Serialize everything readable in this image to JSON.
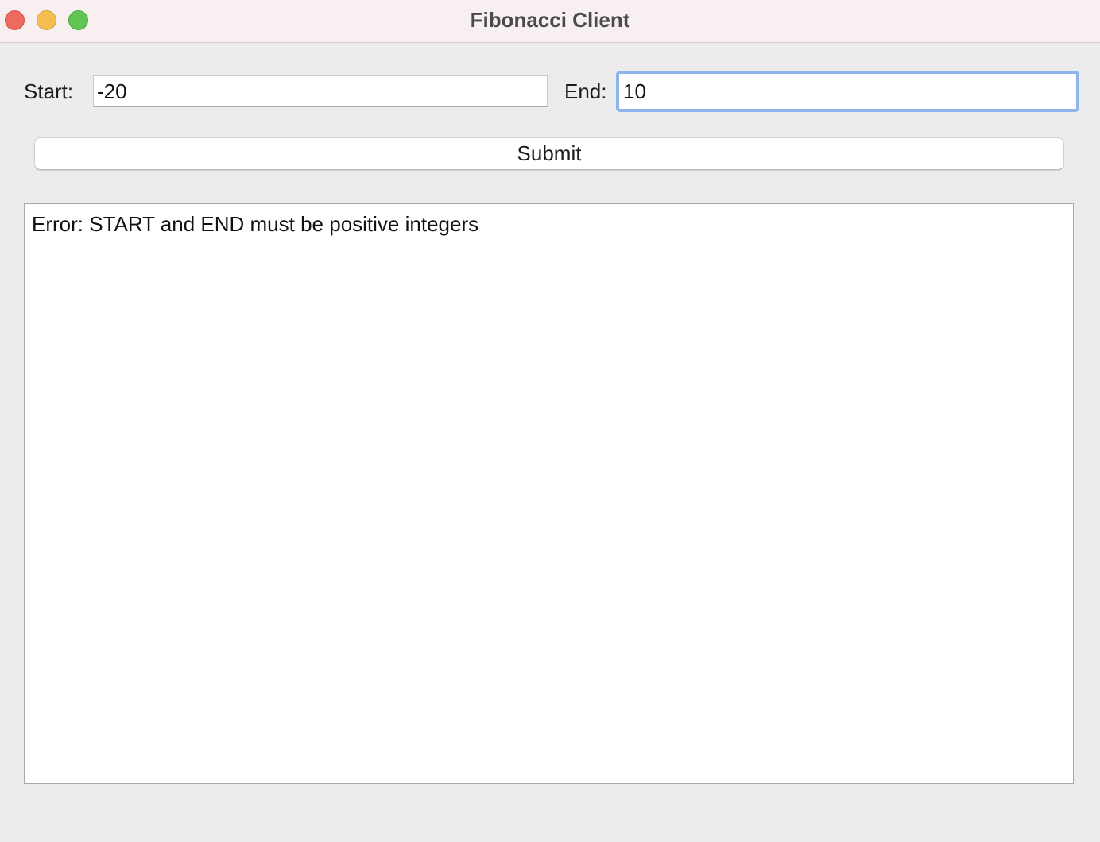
{
  "window": {
    "title": "Fibonacci Client"
  },
  "form": {
    "start_label": "Start:",
    "start_value": "-20",
    "end_label": "End:",
    "end_value": "10",
    "submit_label": "Submit"
  },
  "output": {
    "text": "Error: START and END must be positive integers"
  },
  "colors": {
    "focus_ring": "#8fb4ec",
    "close": "#ec6a5e",
    "minimize": "#f4bf4f",
    "maximize": "#61c554"
  }
}
